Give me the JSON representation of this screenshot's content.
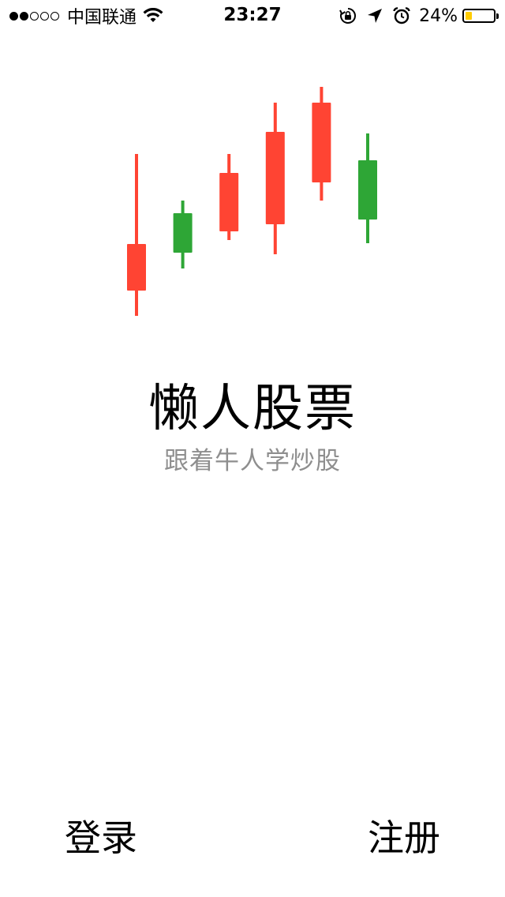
{
  "status_bar": {
    "signal_filled": 2,
    "signal_total": 5,
    "carrier": "中国联通",
    "time": "23:27",
    "battery_percent": "24%",
    "battery_level": 0.24,
    "battery_color": "#ffcc00",
    "icons": [
      "wifi-icon",
      "orientation-lock-icon",
      "location-arrow-icon",
      "alarm-icon",
      "battery-icon"
    ]
  },
  "logo": {
    "kind": "candlestick-logo",
    "up_color": "#ff4433",
    "down_color": "#2ea636",
    "candles": [
      {
        "low": 20,
        "open": 52,
        "close": 111,
        "high": 225,
        "direction": "up"
      },
      {
        "low": 80,
        "open": 100,
        "close": 150,
        "high": 166,
        "direction": "down"
      },
      {
        "low": 116,
        "open": 127,
        "close": 201,
        "high": 225,
        "direction": "up"
      },
      {
        "low": 98,
        "open": 136,
        "close": 253,
        "high": 290,
        "direction": "up"
      },
      {
        "low": 166,
        "open": 189,
        "close": 290,
        "high": 320,
        "direction": "up"
      },
      {
        "low": 112,
        "open": 142,
        "close": 217,
        "high": 251,
        "direction": "down"
      }
    ]
  },
  "app": {
    "title": "懒人股票",
    "subtitle": "跟着牛人学炒股"
  },
  "actions": {
    "login_label": "登录",
    "register_label": "注册"
  }
}
